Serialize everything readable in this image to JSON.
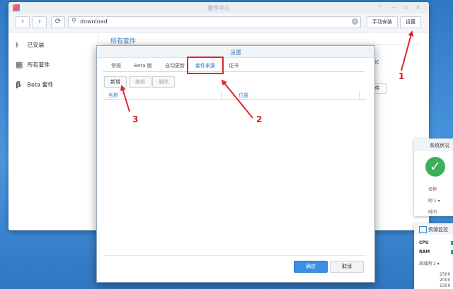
{
  "window": {
    "title": "套件中心",
    "controls": [
      "?",
      "—",
      "▭",
      "✕"
    ]
  },
  "toolbar": {
    "back_icon": "‹",
    "forward_icon": "›",
    "refresh_icon": "⟳",
    "search_value": "download",
    "manual_install_label": "手动安装",
    "settings_label": "设置"
  },
  "sidebar": {
    "items": [
      {
        "label": "已安装",
        "icon": "download-tray-icon"
      },
      {
        "label": "所有套件",
        "icon": "grid-icon"
      },
      {
        "label": "Beta 套件",
        "icon": "beta-icon"
      }
    ]
  },
  "main": {
    "title": "所有套件",
    "peek_text": "ic",
    "peek_button": "件"
  },
  "modal": {
    "title": "设置",
    "tabs": [
      "常规",
      "Beta 版",
      "自动更新",
      "套件来源",
      "证书"
    ],
    "active_tab": "套件来源",
    "actions": {
      "add": "新增",
      "edit": "编辑",
      "delete": "删除"
    },
    "columns": {
      "name": "名称",
      "location": "位置"
    },
    "ok_label": "确定",
    "cancel_label": "取消"
  },
  "widgets": {
    "system": {
      "title": "系统状况",
      "line1": "名称",
      "line2": "网 1 ▾",
      "line3": "时间"
    },
    "resource": {
      "title": "资源监控",
      "cpu": "CPU",
      "ram": "RAM",
      "net": "局域网 1 ▾",
      "ticks": [
        "2500",
        "2000",
        "1500"
      ]
    }
  },
  "annotations": [
    "1",
    "2",
    "3"
  ],
  "colors": {
    "accent": "#3b82c4",
    "annotation": "#e0262e",
    "ok": "#3a8ee6"
  }
}
